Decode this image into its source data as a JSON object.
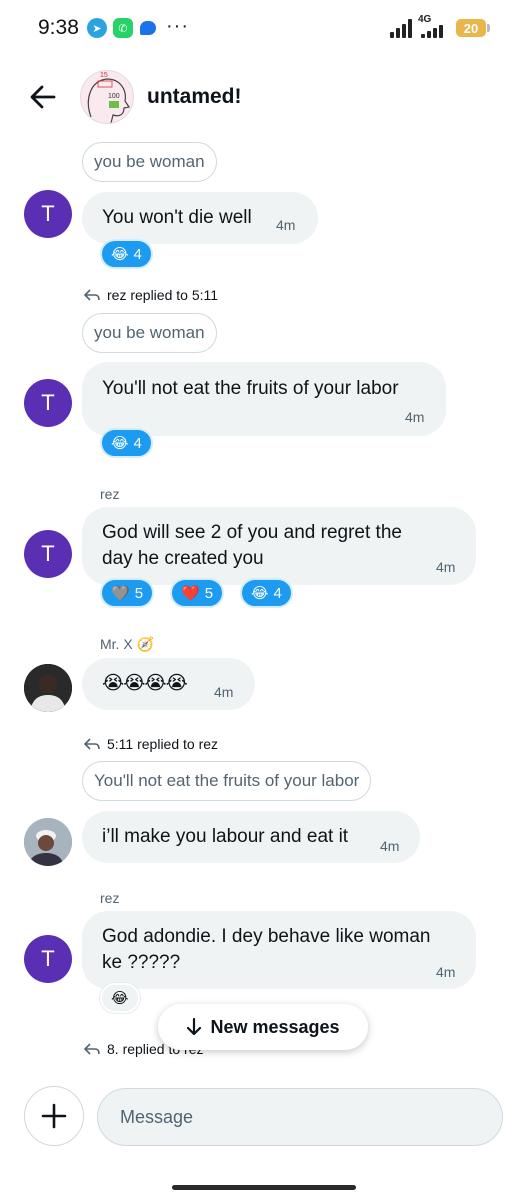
{
  "status_bar": {
    "time": "9:38",
    "network": "4G",
    "battery": "20",
    "more_icon": "···",
    "icons": [
      "telegram-icon",
      "whatsapp-icon",
      "chat-icon",
      "more-dots-icon",
      "signal-icon",
      "battery-icon"
    ]
  },
  "header": {
    "title": "untamed!",
    "back_icon": "arrow-left-icon",
    "avatar_text_top": "15",
    "avatar_text_mid": "100"
  },
  "colors": {
    "accent": "#1d9bf0",
    "avatar_purple": "#5b2fb4",
    "bubble_bg": "#eff3f4"
  },
  "messages": {
    "m0": {
      "quote": "you be woman"
    },
    "m1": {
      "avatar": "T",
      "text": "You won't die well",
      "time": "4m",
      "reactions": [
        {
          "emoji": "😂",
          "count": "4"
        }
      ]
    },
    "m2": {
      "reply_meta": "rez replied to 5:11",
      "quote": "you be woman",
      "avatar": "T",
      "text": "You'll not eat the fruits of your labor",
      "time": "4m",
      "reactions": [
        {
          "emoji": "😂",
          "count": "4"
        }
      ]
    },
    "m3": {
      "sender": "rez",
      "avatar": "T",
      "text_line1": "God will see 2 of you and regret the",
      "text_line2": "day he created you",
      "time": "4m",
      "reactions": [
        {
          "emoji": "🩶",
          "count": "5"
        },
        {
          "emoji": "❤️",
          "count": "5"
        },
        {
          "emoji": "😂",
          "count": "4"
        }
      ]
    },
    "m4": {
      "sender": "Mr. X 🧭",
      "text": "😭😭😭😭",
      "time": "4m"
    },
    "m5": {
      "reply_meta": "5:11 replied to rez",
      "quote": "You'll not eat the fruits of your labor",
      "text": "i’ll make you labour and eat it",
      "time": "4m"
    },
    "m6": {
      "sender": "rez",
      "avatar": "T",
      "text_line1": "God adondie. I dey behave like woman",
      "text_line2": "ke ?????",
      "time": "4m",
      "reactions": [
        {
          "emoji": "😂"
        }
      ]
    },
    "m7": {
      "reply_meta": "8. replied to rez"
    }
  },
  "new_messages": {
    "label": "New messages"
  },
  "composer": {
    "placeholder": "Message"
  }
}
